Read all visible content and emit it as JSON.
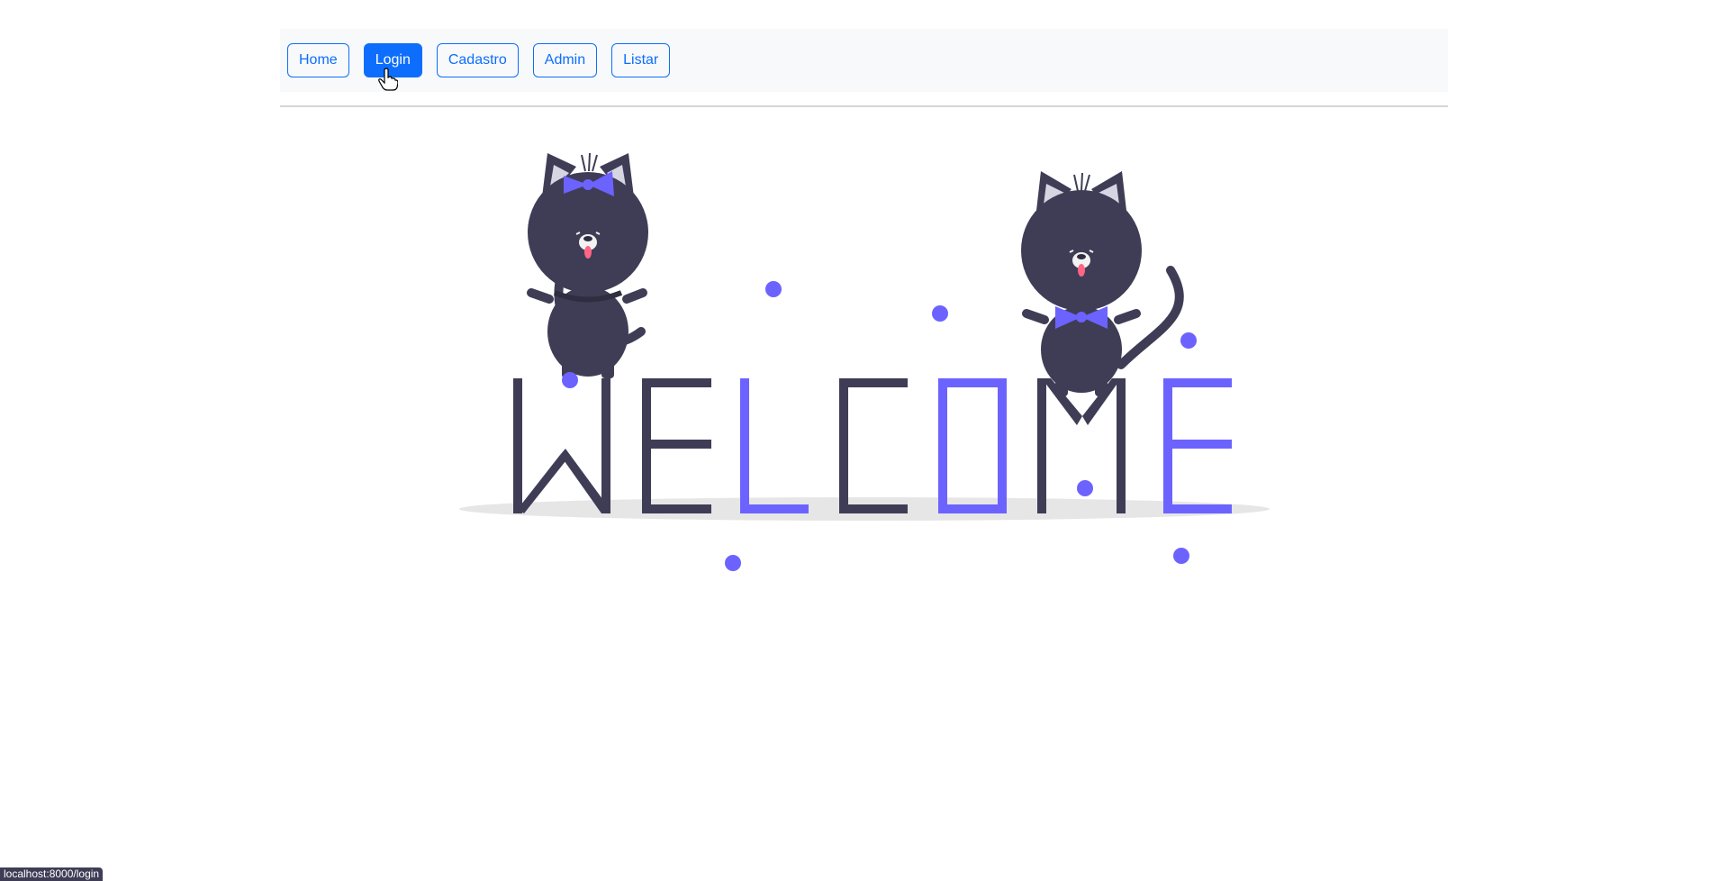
{
  "nav": {
    "buttons": [
      {
        "label": "Home",
        "active": false
      },
      {
        "label": "Login",
        "active": true
      },
      {
        "label": "Cadastro",
        "active": false
      },
      {
        "label": "Admin",
        "active": false
      },
      {
        "label": "Listar",
        "active": false
      }
    ]
  },
  "hero": {
    "illustration": "welcome-cats-illustration",
    "letters": [
      "W",
      "E",
      "L",
      "C",
      "O",
      "M",
      "E"
    ]
  },
  "status_bar": {
    "url": "localhost:8000/login"
  },
  "colors": {
    "accent": "#0d6efd",
    "navbar_bg": "#f8f9fa",
    "illustration_dark": "#3f3d56",
    "illustration_purple": "#6c63ff",
    "tongue": "#ff6584"
  }
}
